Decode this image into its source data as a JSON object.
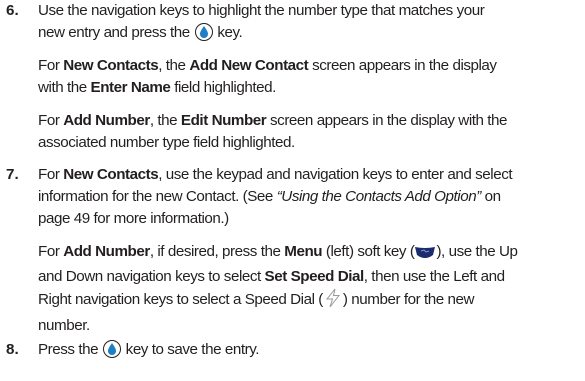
{
  "steps": [
    {
      "number": "6.",
      "line1": "Use the navigation keys to highlight the number type that matches your",
      "line2_pre": "new entry and press the",
      "line2_post": "key.",
      "p1": {
        "pre": "For ",
        "b1": "New Contacts",
        "mid": ", the ",
        "b2": "Add New Contact",
        "post": " screen appears in the display"
      },
      "p1_l2": {
        "pre": "with the ",
        "b1": "Enter Name",
        "post": " field highlighted."
      },
      "p2": {
        "pre": "For ",
        "b1": "Add Number",
        "mid": ", the ",
        "b2": "Edit Number",
        "post": " screen appears in the display with the"
      },
      "p2_l2": "associated number type field highlighted."
    },
    {
      "number": "7.",
      "l1": {
        "pre": "For ",
        "b1": "New Contacts",
        "post": ", use the keypad and navigation keys to enter and select"
      },
      "l2": {
        "pre": "information for the new Contact. (See ",
        "italic": "“Using the Contacts Add Option”",
        "post": " on"
      },
      "l3": "page 49 for more information.)",
      "p1": {
        "pre": "For ",
        "b1": "Add Number",
        "mid1": ", if desired, press the ",
        "b2": "Menu",
        "mid2": " (left) soft key (",
        "post": "), use the Up"
      },
      "p1_l2": {
        "pre": "and Down navigation keys to select ",
        "b1": "Set Speed Dial",
        "post": ", then use the Left and"
      },
      "p1_l3": {
        "pre": "Right navigation keys to select a Speed Dial (",
        "post": ") number for the new"
      },
      "p1_l4": "number."
    },
    {
      "number": "8.",
      "pre": "Press the",
      "post": "key to save the entry."
    }
  ],
  "icons": {
    "ok_key": "ok-center-key-icon",
    "soft_key": "left-soft-key-icon",
    "speed_dial": "speed-dial-lightning-icon"
  }
}
